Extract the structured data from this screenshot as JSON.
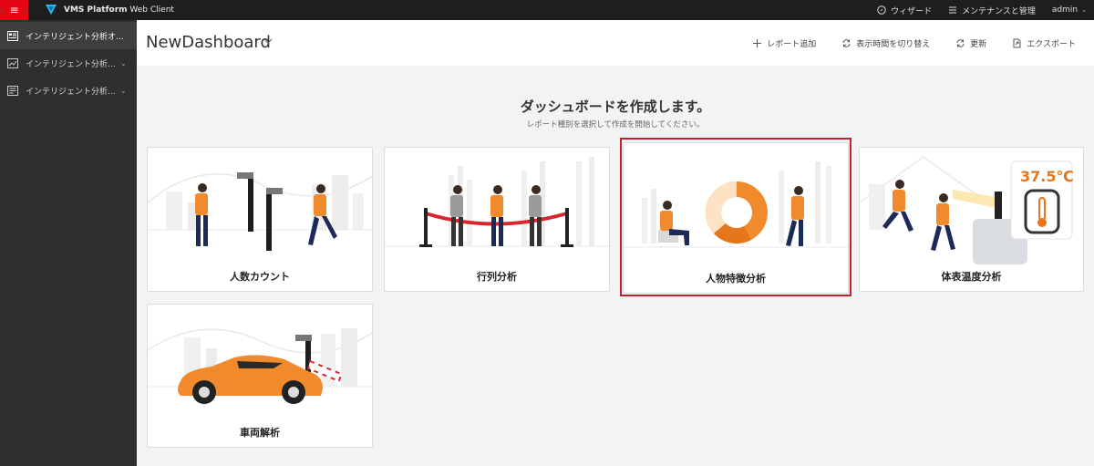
{
  "topbar": {
    "menu_icon": "hamburger-icon",
    "brand_main": "VMS Platform",
    "brand_sub": "Web Client",
    "wizard_label": "ウィザード",
    "maintenance_label": "メンテナンスと管理",
    "user_label": "admin"
  },
  "sidebar": {
    "items": [
      {
        "label": "インテリジェント分析オ...",
        "icon": "dashboard-icon",
        "active": true
      },
      {
        "label": "インテリジェント分析...",
        "icon": "analysis-icon"
      },
      {
        "label": "インテリジェント分析...",
        "icon": "report-icon"
      }
    ]
  },
  "header": {
    "title": "NewDashboard",
    "actions": {
      "add_report": "レポート追加",
      "switch_time": "表示時間を切り替え",
      "refresh": "更新",
      "export": "エクスポート"
    }
  },
  "main": {
    "heading": "ダッシュボードを作成します。",
    "subheading": "レポート種別を選択して作成を開始してください。",
    "cards": [
      {
        "label": "人数カウント"
      },
      {
        "label": "行列分析"
      },
      {
        "label": "人物特徴分析",
        "selected": true
      },
      {
        "label": "体表温度分析",
        "temperature": "37.5℃"
      },
      {
        "label": "車両解析"
      }
    ]
  },
  "colors": {
    "accent_red": "#e30613",
    "highlight": "#c0212c",
    "orange": "#f08a2c",
    "navy": "#1c2a5a"
  }
}
